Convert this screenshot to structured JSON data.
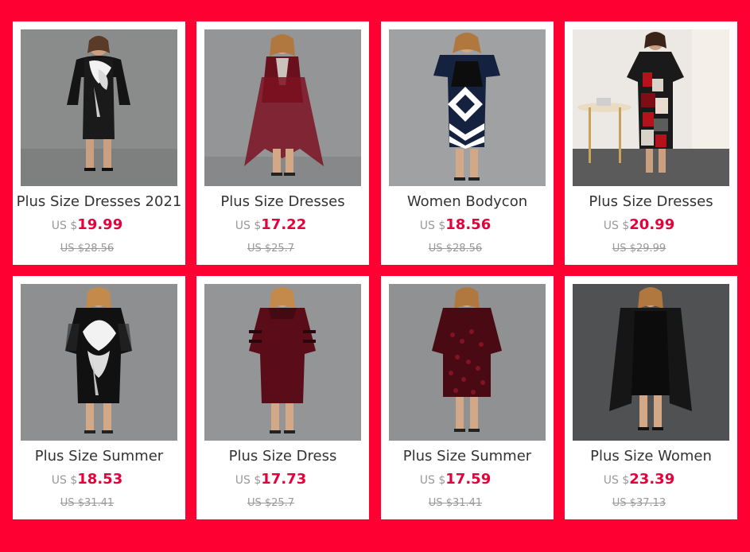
{
  "products": [
    {
      "title": "Plus Size Dresses 2021",
      "currency": "US $",
      "price": "19.99",
      "old_price": "US $28.56",
      "image": "black-white-floral-cape-dress"
    },
    {
      "title": "Plus Size Dresses",
      "currency": "US $",
      "price": "17.22",
      "old_price": "US $25.7",
      "image": "burgundy-chiffon-dress"
    },
    {
      "title": "Women Bodycon",
      "currency": "US $",
      "price": "18.56",
      "old_price": "US $28.56",
      "image": "navy-geometric-dress"
    },
    {
      "title": "Plus Size Dresses",
      "currency": "US $",
      "price": "20.99",
      "old_price": "US $29.99",
      "image": "red-patchwork-dress"
    },
    {
      "title": "Plus Size Summer",
      "currency": "US $",
      "price": "18.53",
      "old_price": "US $31.41",
      "image": "black-white-floral-mesh-dress"
    },
    {
      "title": "Plus Size Dress",
      "currency": "US $",
      "price": "17.73",
      "old_price": "US $25.7",
      "image": "burgundy-mesh-dress"
    },
    {
      "title": "Plus Size Summer",
      "currency": "US $",
      "price": "17.59",
      "old_price": "US $31.41",
      "image": "wine-sequin-dress"
    },
    {
      "title": "Plus Size Women",
      "currency": "US $",
      "price": "23.39",
      "old_price": "US $37.13",
      "image": "black-two-piece-dress"
    }
  ],
  "colors": {
    "background": "#ff0033",
    "price": "#e6003c",
    "muted": "#999999",
    "title": "#333333"
  }
}
